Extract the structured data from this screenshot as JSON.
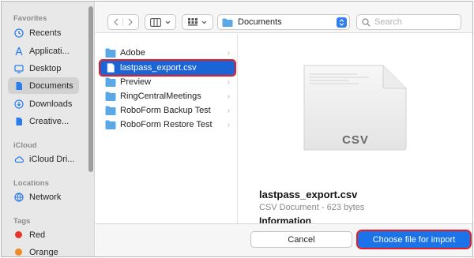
{
  "sidebar": {
    "sections": {
      "favorites": "Favorites",
      "icloud": "iCloud",
      "locations": "Locations",
      "tags": "Tags"
    },
    "favorites": [
      {
        "label": "Recents",
        "icon": "clock-icon"
      },
      {
        "label": "Applicati...",
        "icon": "applications-icon"
      },
      {
        "label": "Desktop",
        "icon": "desktop-icon"
      },
      {
        "label": "Documents",
        "icon": "document-icon",
        "selected": true
      },
      {
        "label": "Downloads",
        "icon": "download-icon"
      },
      {
        "label": "Creative...",
        "icon": "file-icon"
      }
    ],
    "icloud": [
      {
        "label": "iCloud Dri...",
        "icon": "cloud-icon"
      }
    ],
    "locations": [
      {
        "label": "Network",
        "icon": "globe-icon"
      }
    ],
    "tags": [
      {
        "label": "Red",
        "color": "#e5362b"
      },
      {
        "label": "Orange",
        "color": "#f08a24"
      }
    ]
  },
  "toolbar": {
    "path_label": "Documents",
    "search_placeholder": "Search"
  },
  "files": [
    {
      "name": "Adobe",
      "type": "folder"
    },
    {
      "name": "lastpass_export.csv",
      "type": "file",
      "selected": true
    },
    {
      "name": "Preview",
      "type": "folder"
    },
    {
      "name": "RingCentralMeetings",
      "type": "folder"
    },
    {
      "name": "RoboForm Backup Test",
      "type": "folder"
    },
    {
      "name": "RoboForm Restore Test",
      "type": "folder"
    }
  ],
  "preview": {
    "doc_label": "CSV",
    "filename": "lastpass_export.csv",
    "kind": "CSV Document - 623 bytes",
    "info": "Information"
  },
  "buttons": {
    "cancel": "Cancel",
    "choose": "Choose file for import"
  },
  "colors": {
    "accent": "#1a73e8",
    "highlight_outline": "#e51c23",
    "folder": "#5aa9e6"
  }
}
